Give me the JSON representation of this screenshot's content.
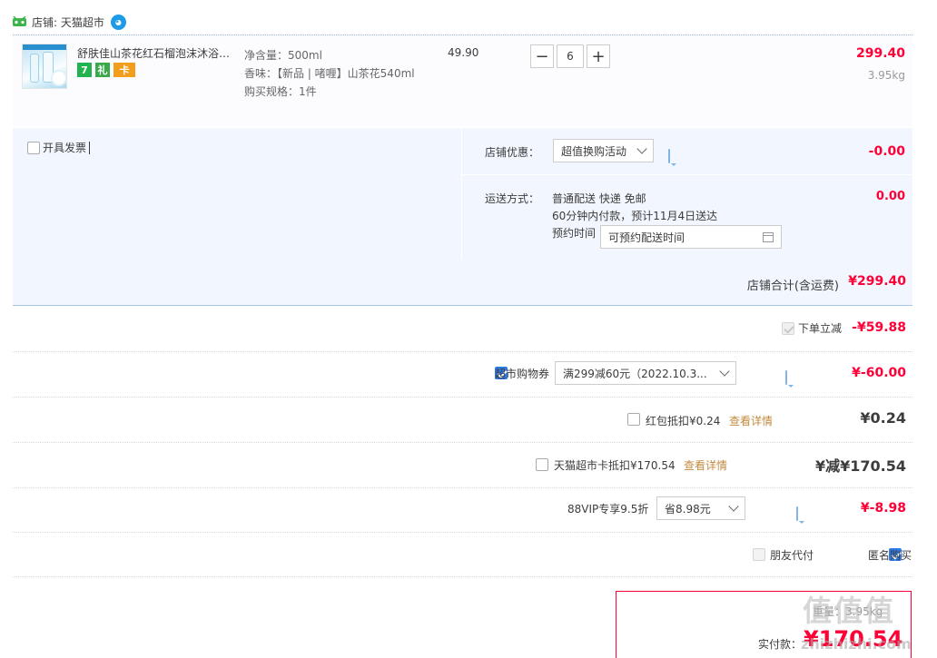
{
  "shop": {
    "label": "店铺: 天猫超市"
  },
  "item": {
    "title": "舒肤佳山茶花红石榴泡沫沐浴露...",
    "sku_lines": [
      "净含量：500ml",
      "香味：【新品 | 啫喱】山茶花540ml",
      "购买规格：1件"
    ],
    "unit_price": "49.90",
    "quantity": "6",
    "total": "299.40",
    "weight": "3.95kg",
    "badges": {
      "seven": "7",
      "gift": "礼",
      "card": "卡"
    }
  },
  "invoice": {
    "label": "开具发票"
  },
  "shop_discount": {
    "label": "店铺优惠：",
    "selected": "超值换购活动",
    "value": "-0.00"
  },
  "shipping": {
    "label": "运送方式：",
    "line1": "普通配送 快递 免邮",
    "line2": "60分钟内付款，预计11月4日送达",
    "reserve_label": "预约时间",
    "reserve_placeholder": "可预约配送时间",
    "value": "0.00"
  },
  "shop_total": {
    "label": "店铺合计(含运费)",
    "value": "¥299.40"
  },
  "instant_discount": {
    "label": "下单立减",
    "value": "-¥59.88"
  },
  "coupon": {
    "label": "超市购物券",
    "selected": "满299减60元（2022.10.3...",
    "value": "¥-60.00"
  },
  "red_packet": {
    "label": "红包抵扣¥0.24",
    "link": "查看详情",
    "value": "¥0.24"
  },
  "tmall_card": {
    "label": "天猫超市卡抵扣¥170.54",
    "link": "查看详情",
    "value": "¥减¥170.54"
  },
  "vip": {
    "label": "88VIP专享9.5折",
    "selected": "省8.98元",
    "value": "¥-8.98"
  },
  "pay_options": {
    "friend_pay": "朋友代付",
    "anonymous": "匿名购买"
  },
  "final": {
    "label": "实付款：",
    "weight": "重量：3.95kg",
    "value": "¥170.54"
  },
  "watermark": {
    "text": "值值值",
    "site": "zhizhizhi.com"
  },
  "colors": {
    "red": "#ff0036",
    "blue_bg": "#f2f7ff",
    "check_blue": "#2f7be6"
  }
}
